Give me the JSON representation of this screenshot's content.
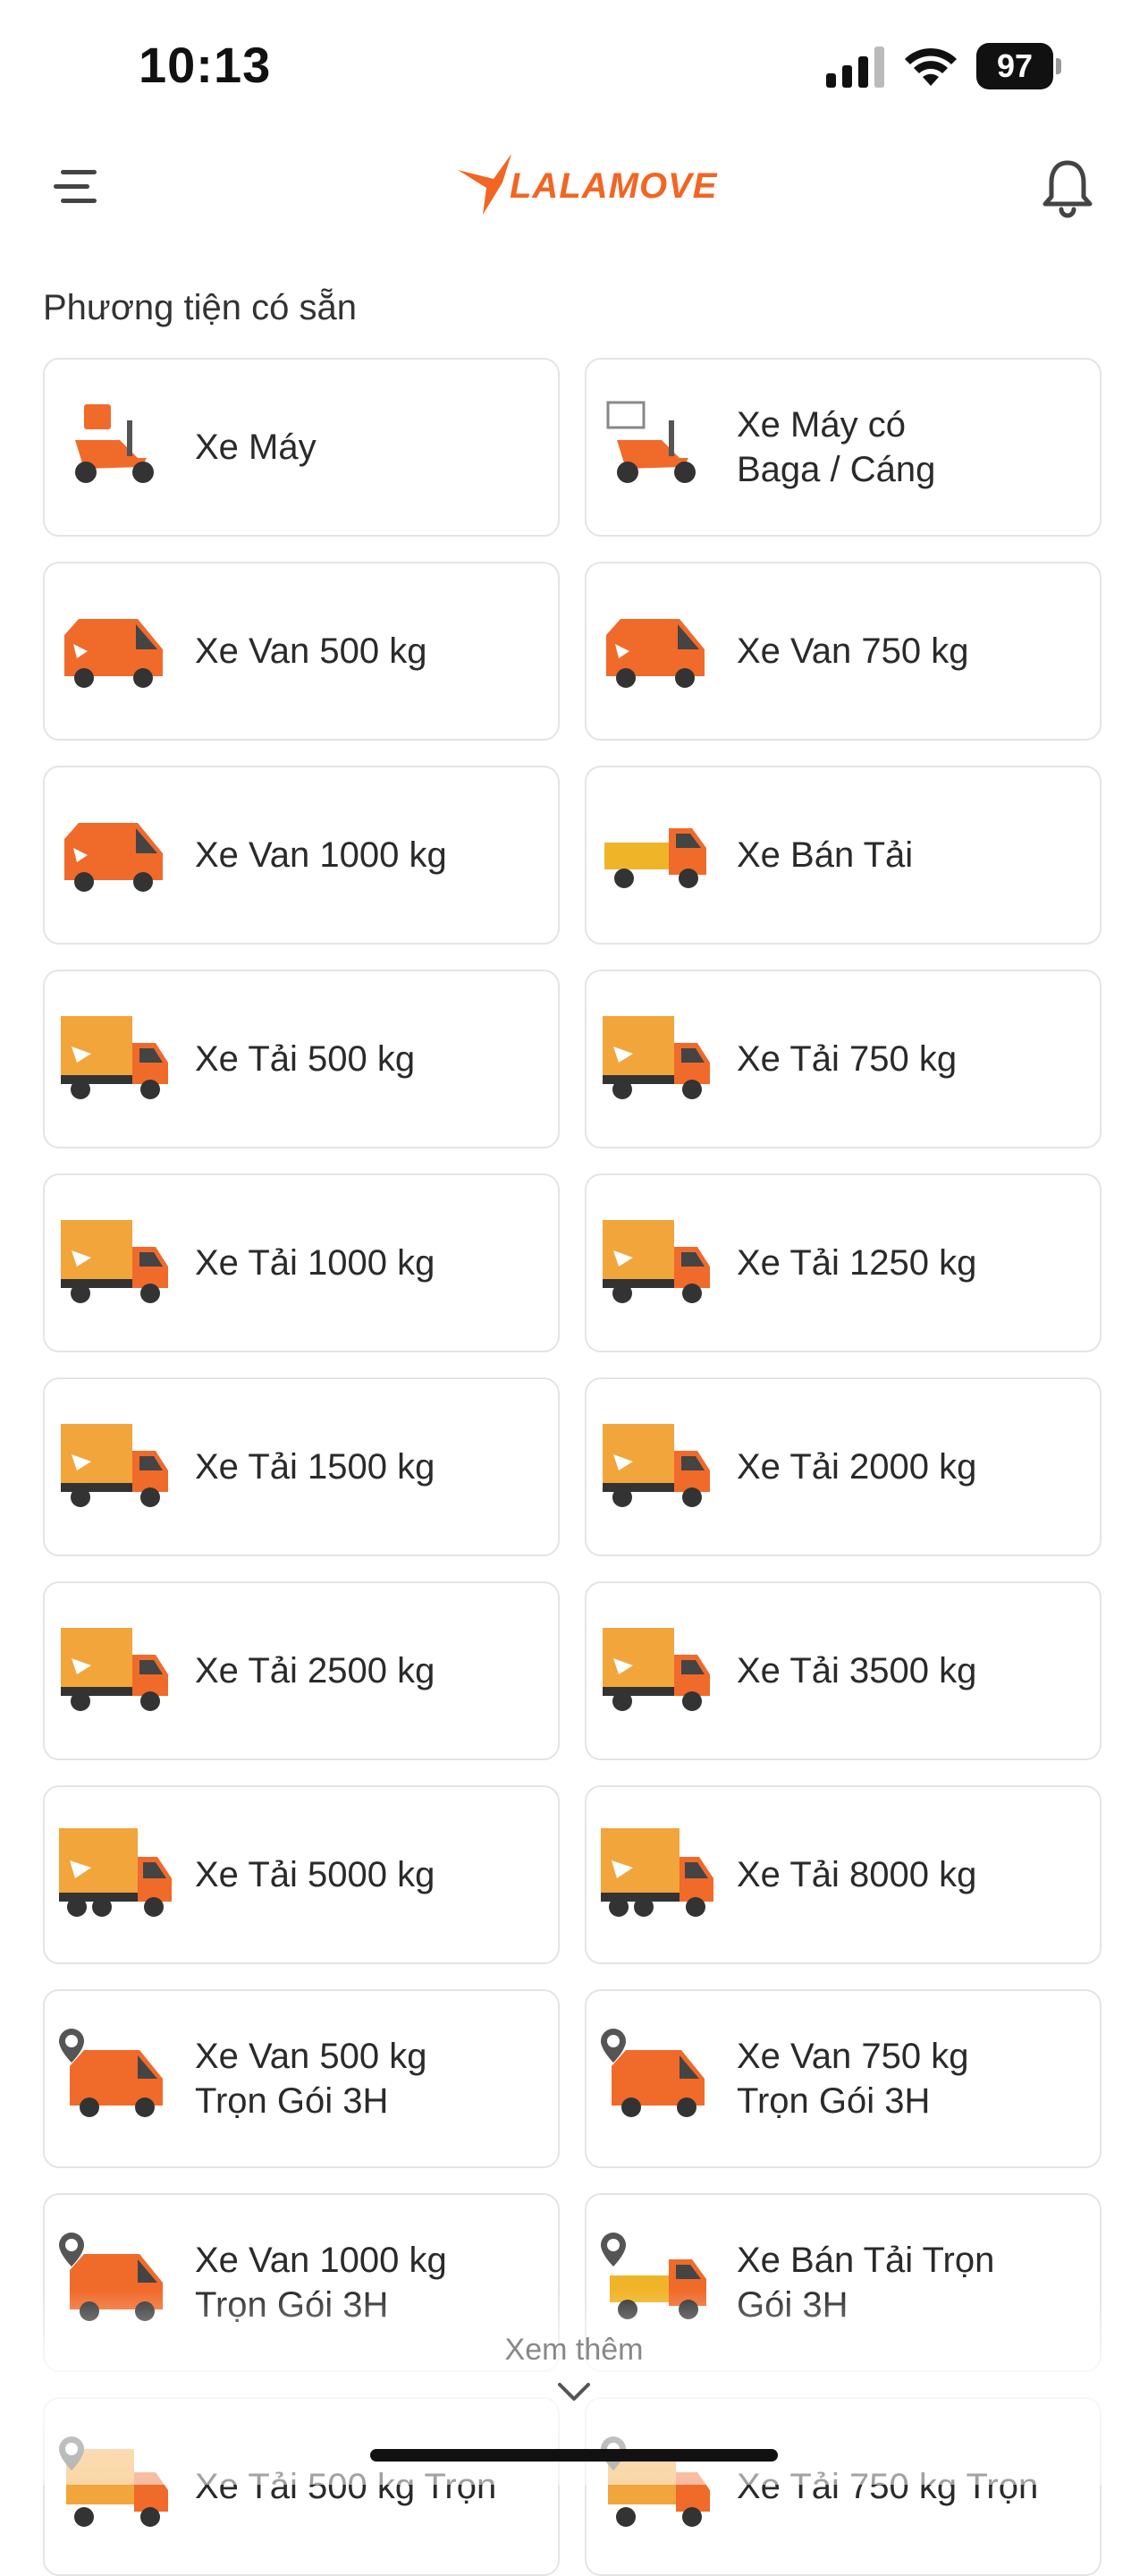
{
  "status_bar": {
    "time": "10:13",
    "battery": "97"
  },
  "header": {
    "logo_text": "LALAMOVE"
  },
  "section_title": "Phương tiện có sẵn",
  "colors": {
    "brand": "#f26522",
    "card_border": "#e4e4e4",
    "truck_box": "#f2a53a",
    "van": "#f06a2a",
    "pickup_bed": "#f0b429"
  },
  "vehicles": [
    {
      "label": "Xe Máy",
      "icon": "scooter-icon"
    },
    {
      "label": "Xe Máy có\nBaga / Cáng",
      "icon": "scooter-rack-icon"
    },
    {
      "label": "Xe Van 500 kg",
      "icon": "van-icon"
    },
    {
      "label": "Xe Van 750 kg",
      "icon": "van-icon"
    },
    {
      "label": "Xe Van 1000 kg",
      "icon": "van-icon"
    },
    {
      "label": "Xe Bán Tải",
      "icon": "pickup-truck-icon"
    },
    {
      "label": "Xe Tải 500 kg",
      "icon": "box-truck-icon"
    },
    {
      "label": "Xe Tải 750 kg",
      "icon": "box-truck-icon"
    },
    {
      "label": "Xe Tải 1000 kg",
      "icon": "box-truck-icon"
    },
    {
      "label": "Xe Tải 1250 kg",
      "icon": "box-truck-icon"
    },
    {
      "label": "Xe Tải 1500 kg",
      "icon": "box-truck-icon"
    },
    {
      "label": "Xe Tải 2000 kg",
      "icon": "box-truck-icon"
    },
    {
      "label": "Xe Tải 2500 kg",
      "icon": "box-truck-icon"
    },
    {
      "label": "Xe Tải 3500 kg",
      "icon": "box-truck-icon"
    },
    {
      "label": "Xe Tải 5000 kg",
      "icon": "big-box-truck-icon"
    },
    {
      "label": "Xe Tải 8000 kg",
      "icon": "big-box-truck-icon"
    },
    {
      "label": "Xe Van 500 kg\nTrọn Gói 3H",
      "icon": "van-timed-icon"
    },
    {
      "label": "Xe Van 750 kg\nTrọn Gói 3H",
      "icon": "van-timed-icon"
    },
    {
      "label": "Xe Van 1000 kg\nTrọn Gói 3H",
      "icon": "van-timed-icon"
    },
    {
      "label": "Xe Bán Tải Trọn\nGói 3H",
      "icon": "pickup-timed-icon"
    },
    {
      "label": "Xe Tải 500 kg Trọn",
      "icon": "truck-timed-icon"
    },
    {
      "label": "Xe Tải 750 kg Trọn",
      "icon": "truck-timed-icon"
    }
  ],
  "see_more": "Xem thêm"
}
